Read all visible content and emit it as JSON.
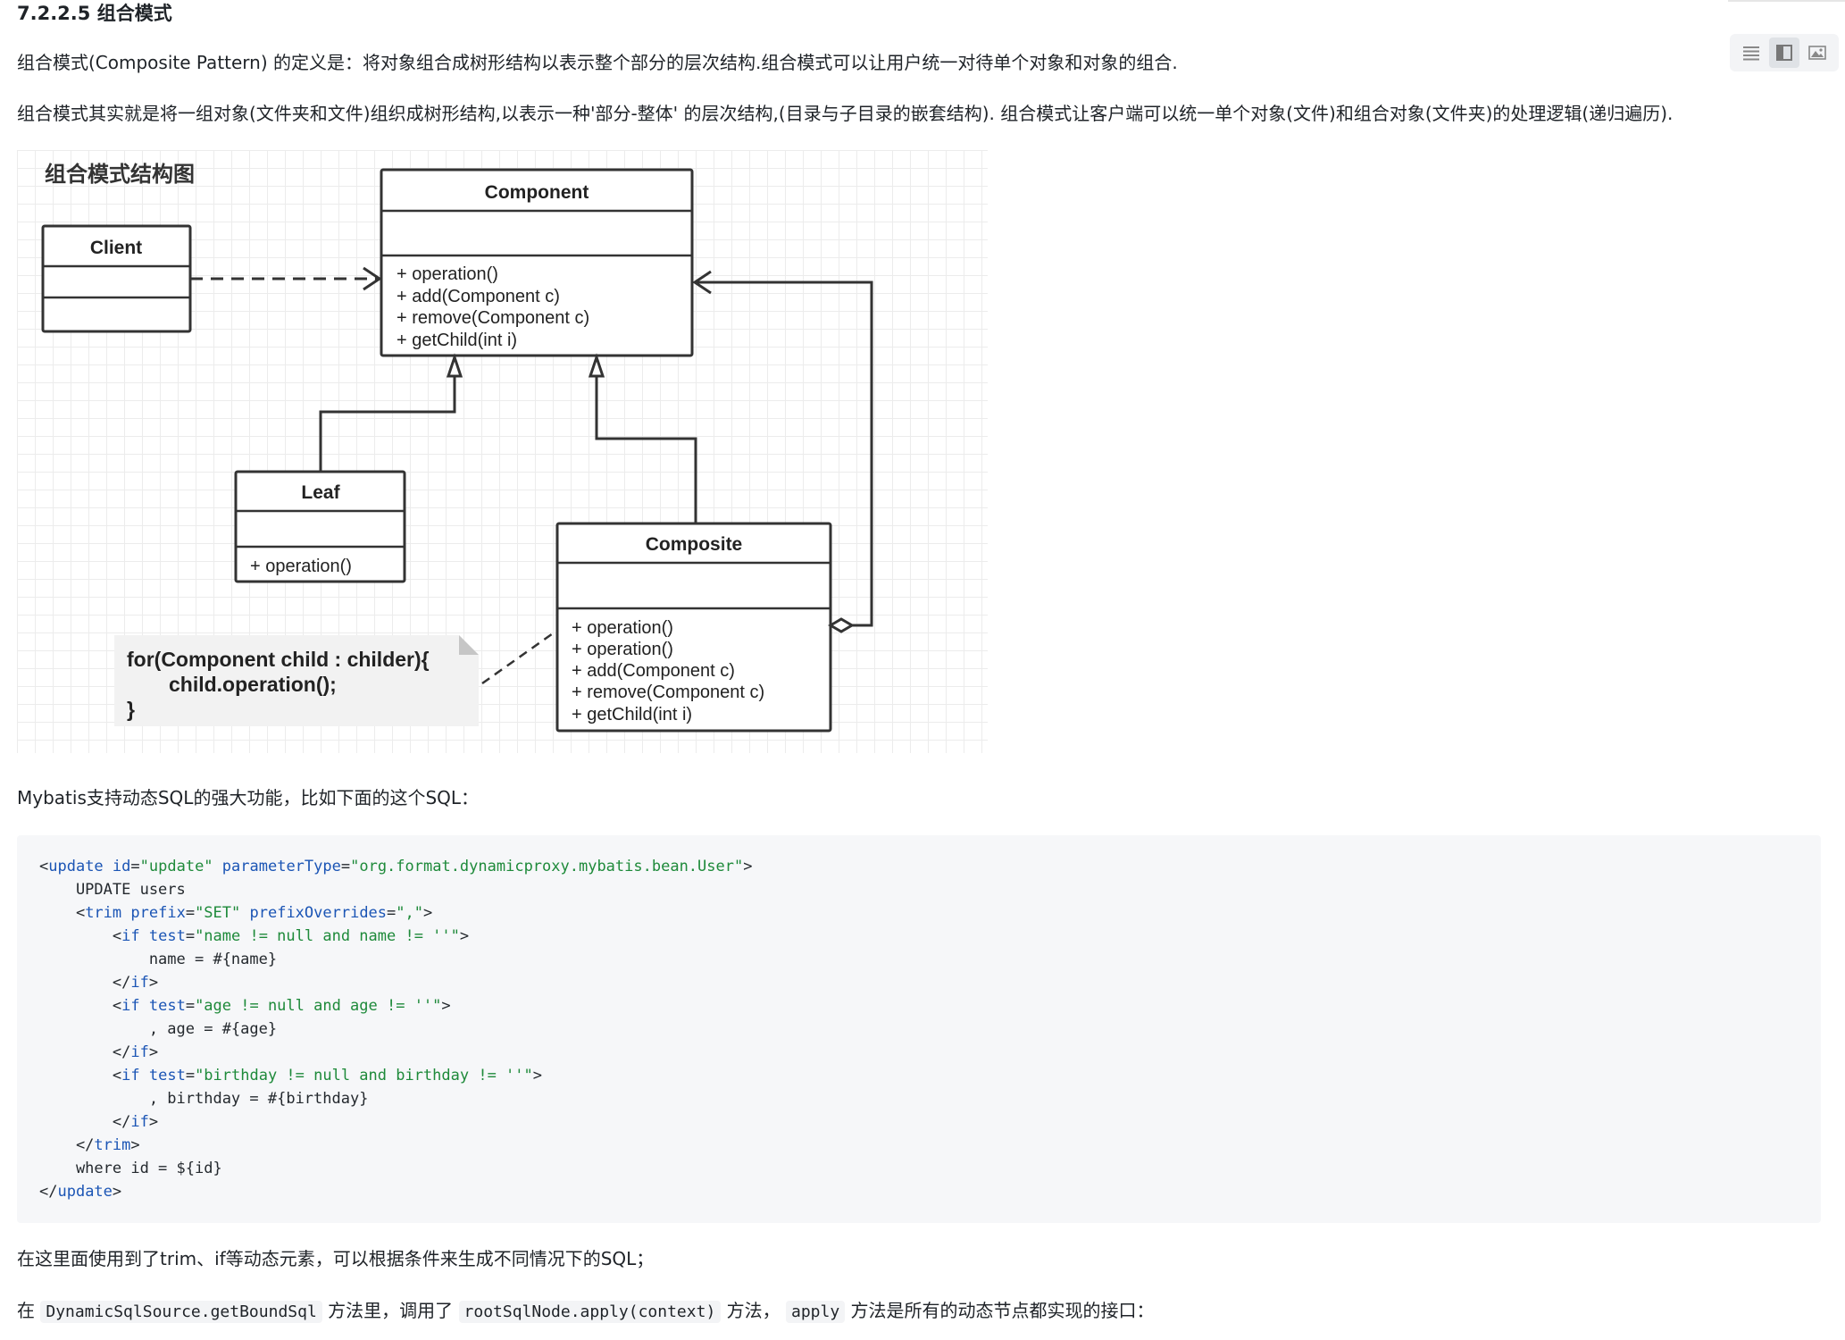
{
  "heading": "7.2.2.5 组合模式",
  "paragraphs": {
    "p1": "组合模式(Composite Pattern) 的定义是：将对象组合成树形结构以表示整个部分的层次结构.组合模式可以让用户统一对待单个对象和对象的组合.",
    "p2": "组合模式其实就是将一组对象(文件夹和文件)组织成树形结构,以表示一种'部分-整体' 的层次结构,(目录与子目录的嵌套结构). 组合模式让客户端可以统一单个对象(文件)和组合对象(文件夹)的处理逻辑(递归遍历).",
    "p3": "Mybatis支持动态SQL的强大功能，比如下面的这个SQL：",
    "p4": "在这里面使用到了trim、if等动态元素，可以根据条件来生成不同情况下的SQL；",
    "p5": {
      "prefix": "在",
      "code1": "DynamicSqlSource.getBoundSql",
      "mid1": "方法里，调用了",
      "code2": "rootSqlNode.apply(context)",
      "mid2": "方法，",
      "code3": "apply",
      "suffix": "方法是所有的动态节点都实现的接口："
    }
  },
  "toolbar": {
    "icons": [
      "list-view-icon",
      "split-view-icon",
      "image-view-icon"
    ],
    "active": "split-view-icon"
  },
  "diagram": {
    "title": "组合模式结构图",
    "component": {
      "name": "Component",
      "methods": [
        "+ operation()",
        "+ add(Component c)",
        "+ remove(Component c)",
        "+ getChild(int i)"
      ]
    },
    "client": {
      "name": "Client"
    },
    "leaf": {
      "name": "Leaf",
      "methods": [
        "+ operation()"
      ]
    },
    "composite": {
      "name": "Composite",
      "methods": [
        "+ operation()",
        "+ operation()",
        "+ add(Component c)",
        "+ remove(Component c)",
        "+ getChild(int i)"
      ]
    },
    "note": {
      "lines": [
        "for(Component child : childer){",
        "child.operation();",
        "}"
      ]
    }
  },
  "code": {
    "lines": [
      [
        [
          "p",
          "<"
        ],
        [
          "tag",
          "update"
        ],
        [
          "p",
          " "
        ],
        [
          "attr",
          "id"
        ],
        [
          "p",
          "="
        ],
        [
          "str",
          "\"update\""
        ],
        [
          "p",
          " "
        ],
        [
          "attr",
          "parameterType"
        ],
        [
          "p",
          "="
        ],
        [
          "str",
          "\"org.format.dynamicproxy.mybatis.bean.User\""
        ],
        [
          "p",
          ">"
        ]
      ],
      [
        [
          "p",
          "    UPDATE users"
        ]
      ],
      [
        [
          "p",
          "    <"
        ],
        [
          "tag",
          "trim"
        ],
        [
          "p",
          " "
        ],
        [
          "attr",
          "prefix"
        ],
        [
          "p",
          "="
        ],
        [
          "str",
          "\"SET\""
        ],
        [
          "p",
          " "
        ],
        [
          "attr",
          "prefixOverrides"
        ],
        [
          "p",
          "="
        ],
        [
          "str",
          "\",\""
        ],
        [
          "p",
          ">"
        ]
      ],
      [
        [
          "p",
          "        <"
        ],
        [
          "tag",
          "if"
        ],
        [
          "p",
          " "
        ],
        [
          "attr",
          "test"
        ],
        [
          "p",
          "="
        ],
        [
          "str",
          "\"name != null and name != ''\""
        ],
        [
          "p",
          ">"
        ]
      ],
      [
        [
          "p",
          "            name = #{name}"
        ]
      ],
      [
        [
          "p",
          "        </"
        ],
        [
          "tag",
          "if"
        ],
        [
          "p",
          ">"
        ]
      ],
      [
        [
          "p",
          "        <"
        ],
        [
          "tag",
          "if"
        ],
        [
          "p",
          " "
        ],
        [
          "attr",
          "test"
        ],
        [
          "p",
          "="
        ],
        [
          "str",
          "\"age != null and age != ''\""
        ],
        [
          "p",
          ">"
        ]
      ],
      [
        [
          "p",
          "            , age = #{age}"
        ]
      ],
      [
        [
          "p",
          "        </"
        ],
        [
          "tag",
          "if"
        ],
        [
          "p",
          ">"
        ]
      ],
      [
        [
          "p",
          "        <"
        ],
        [
          "tag",
          "if"
        ],
        [
          "p",
          " "
        ],
        [
          "attr",
          "test"
        ],
        [
          "p",
          "="
        ],
        [
          "str",
          "\"birthday != null and birthday != ''\""
        ],
        [
          "p",
          ">"
        ]
      ],
      [
        [
          "p",
          "            , birthday = #{birthday}"
        ]
      ],
      [
        [
          "p",
          "        </"
        ],
        [
          "tag",
          "if"
        ],
        [
          "p",
          ">"
        ]
      ],
      [
        [
          "p",
          "    </"
        ],
        [
          "tag",
          "trim"
        ],
        [
          "p",
          ">"
        ]
      ],
      [
        [
          "p",
          "    where id = ${id}"
        ]
      ],
      [
        [
          "p",
          "</"
        ],
        [
          "tag",
          "update"
        ],
        [
          "p",
          ">"
        ]
      ]
    ]
  }
}
